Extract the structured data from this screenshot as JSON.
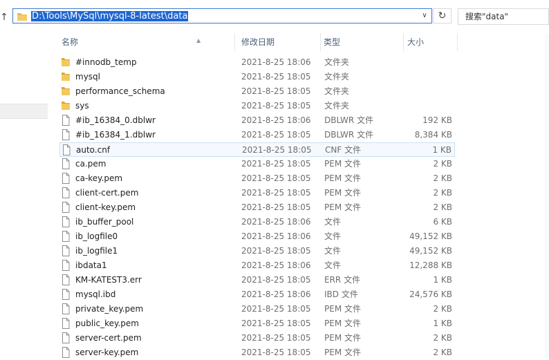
{
  "address": {
    "path": "D:\\Tools\\MySql\\mysql-8-latest\\data"
  },
  "search": {
    "placeholder": "搜索\"data\""
  },
  "columns": {
    "name": "名称",
    "date": "修改日期",
    "type": "类型",
    "size": "大小"
  },
  "files": [
    {
      "name": "#innodb_temp",
      "date": "2021-8-25 18:06",
      "type": "文件夹",
      "size": "",
      "kind": "folder"
    },
    {
      "name": "mysql",
      "date": "2021-8-25 18:05",
      "type": "文件夹",
      "size": "",
      "kind": "folder"
    },
    {
      "name": "performance_schema",
      "date": "2021-8-25 18:05",
      "type": "文件夹",
      "size": "",
      "kind": "folder"
    },
    {
      "name": "sys",
      "date": "2021-8-25 18:05",
      "type": "文件夹",
      "size": "",
      "kind": "folder"
    },
    {
      "name": "#ib_16384_0.dblwr",
      "date": "2021-8-25 18:06",
      "type": "DBLWR 文件",
      "size": "192 KB",
      "kind": "file"
    },
    {
      "name": "#ib_16384_1.dblwr",
      "date": "2021-8-25 18:05",
      "type": "DBLWR 文件",
      "size": "8,384 KB",
      "kind": "file"
    },
    {
      "name": "auto.cnf",
      "date": "2021-8-25 18:05",
      "type": "CNF 文件",
      "size": "1 KB",
      "kind": "file",
      "selected": true
    },
    {
      "name": "ca.pem",
      "date": "2021-8-25 18:05",
      "type": "PEM 文件",
      "size": "2 KB",
      "kind": "file"
    },
    {
      "name": "ca-key.pem",
      "date": "2021-8-25 18:05",
      "type": "PEM 文件",
      "size": "2 KB",
      "kind": "file"
    },
    {
      "name": "client-cert.pem",
      "date": "2021-8-25 18:05",
      "type": "PEM 文件",
      "size": "2 KB",
      "kind": "file"
    },
    {
      "name": "client-key.pem",
      "date": "2021-8-25 18:05",
      "type": "PEM 文件",
      "size": "2 KB",
      "kind": "file"
    },
    {
      "name": "ib_buffer_pool",
      "date": "2021-8-25 18:06",
      "type": "文件",
      "size": "6 KB",
      "kind": "file"
    },
    {
      "name": "ib_logfile0",
      "date": "2021-8-25 18:06",
      "type": "文件",
      "size": "49,152 KB",
      "kind": "file"
    },
    {
      "name": "ib_logfile1",
      "date": "2021-8-25 18:05",
      "type": "文件",
      "size": "49,152 KB",
      "kind": "file"
    },
    {
      "name": "ibdata1",
      "date": "2021-8-25 18:06",
      "type": "文件",
      "size": "12,288 KB",
      "kind": "file"
    },
    {
      "name": "KM-KATEST3.err",
      "date": "2021-8-25 18:05",
      "type": "ERR 文件",
      "size": "1 KB",
      "kind": "file"
    },
    {
      "name": "mysql.ibd",
      "date": "2021-8-25 18:06",
      "type": "IBD 文件",
      "size": "24,576 KB",
      "kind": "file"
    },
    {
      "name": "private_key.pem",
      "date": "2021-8-25 18:05",
      "type": "PEM 文件",
      "size": "2 KB",
      "kind": "file"
    },
    {
      "name": "public_key.pem",
      "date": "2021-8-25 18:05",
      "type": "PEM 文件",
      "size": "1 KB",
      "kind": "file"
    },
    {
      "name": "server-cert.pem",
      "date": "2021-8-25 18:05",
      "type": "PEM 文件",
      "size": "2 KB",
      "kind": "file"
    },
    {
      "name": "server-key.pem",
      "date": "2021-8-25 18:05",
      "type": "PEM 文件",
      "size": "2 KB",
      "kind": "file"
    }
  ],
  "colors": {
    "accent": "#1f66d1",
    "folder": "#e8b84a",
    "selection_border": "#cce0f5"
  }
}
